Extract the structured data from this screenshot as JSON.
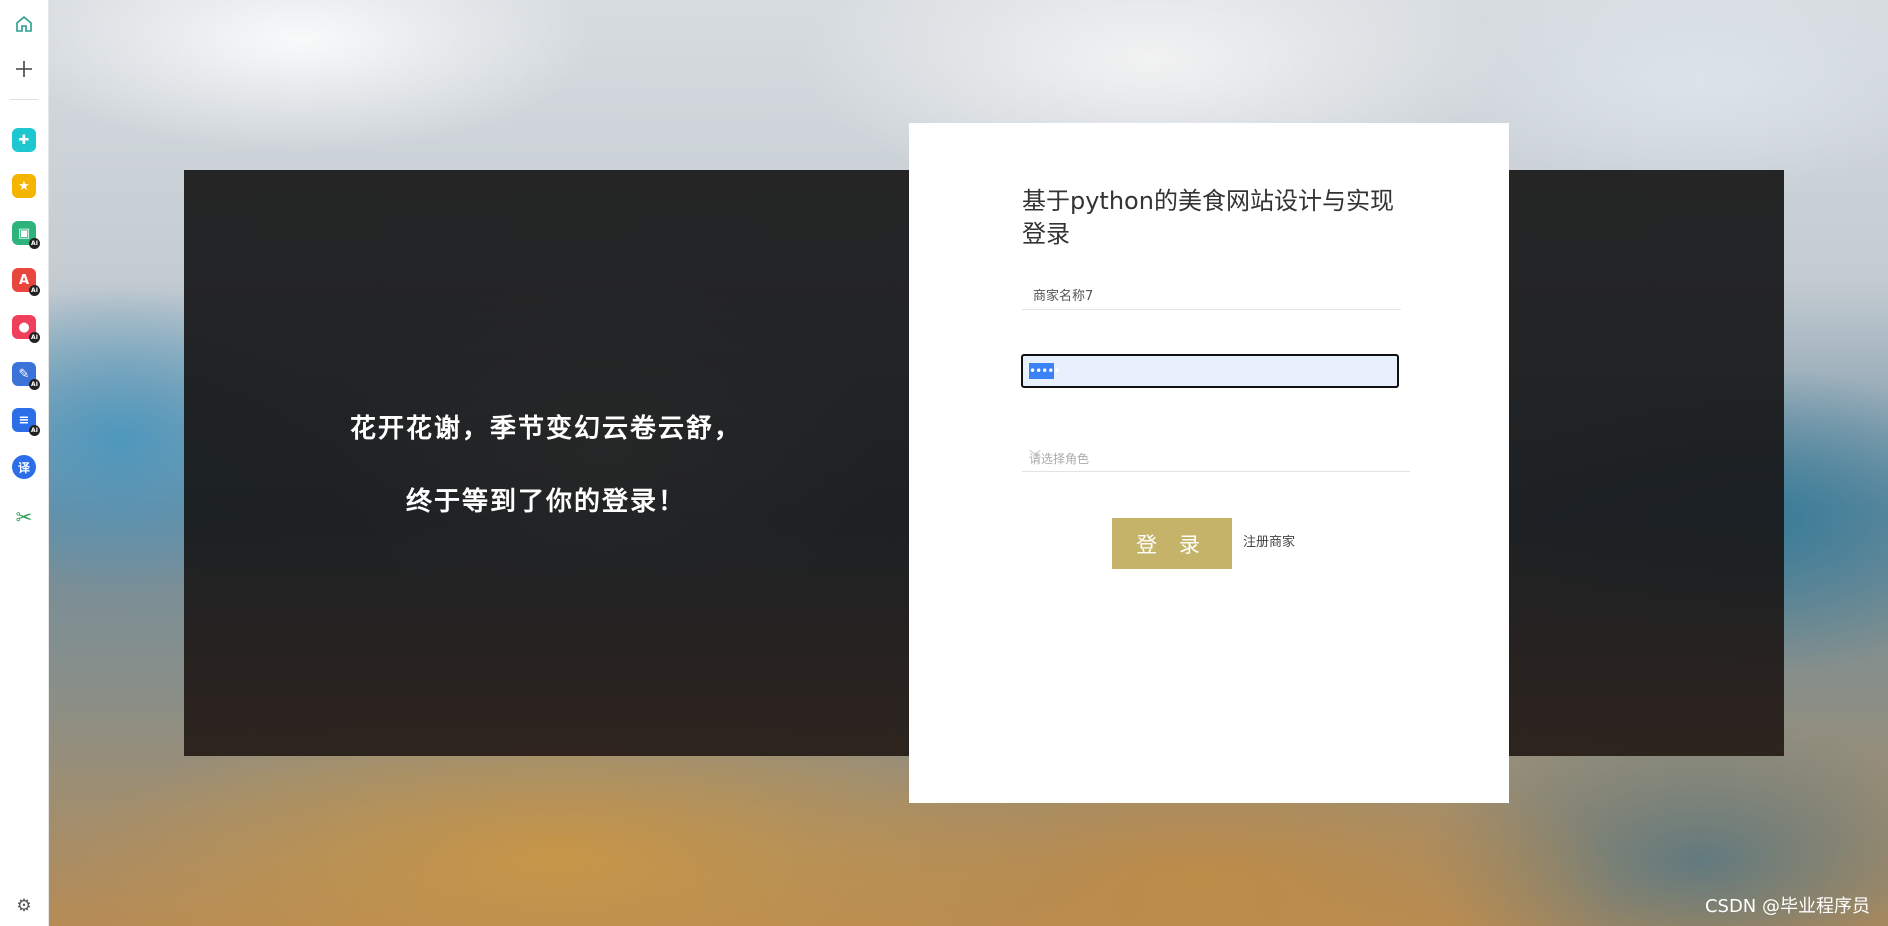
{
  "sidebar": {
    "items": [
      {
        "name": "home-icon",
        "glyph": "⌂"
      },
      {
        "name": "add-icon",
        "glyph": "+"
      },
      {
        "name": "app-tile-cross",
        "glyph": "✚",
        "color": "#1cc7d0"
      },
      {
        "name": "app-tile-star",
        "glyph": "★",
        "color": "#f5b400"
      },
      {
        "name": "app-tile-image",
        "glyph": "▣",
        "color": "#2db37b"
      },
      {
        "name": "app-tile-pdf",
        "glyph": "A",
        "color": "#e8453c"
      },
      {
        "name": "app-tile-record",
        "glyph": "●",
        "color": "#ef3f5b"
      },
      {
        "name": "app-tile-edit",
        "glyph": "✎",
        "color": "#3b73d9"
      },
      {
        "name": "app-tile-doc",
        "glyph": "≡",
        "color": "#2b6ee8"
      },
      {
        "name": "app-tile-translate",
        "glyph": "译",
        "color": "#2b6ee8"
      },
      {
        "name": "scissors-icon",
        "glyph": "✂",
        "color": "#2f9e5a"
      }
    ],
    "settings_glyph": "⚙"
  },
  "slogan": {
    "line1": "花开花谢，季节变幻云卷云舒，",
    "line2": "终于等到了你的登录！"
  },
  "login": {
    "title_line1": "基于python的美食网站设计与实现",
    "title_line2": "登录",
    "username_value": "商家名称7",
    "password_mask": "•••••",
    "role_placeholder": "请选择角色",
    "login_button": "登 录",
    "register_link": "注册商家",
    "accent_color": "#c6b36a"
  },
  "watermark": "CSDN @毕业程序员"
}
